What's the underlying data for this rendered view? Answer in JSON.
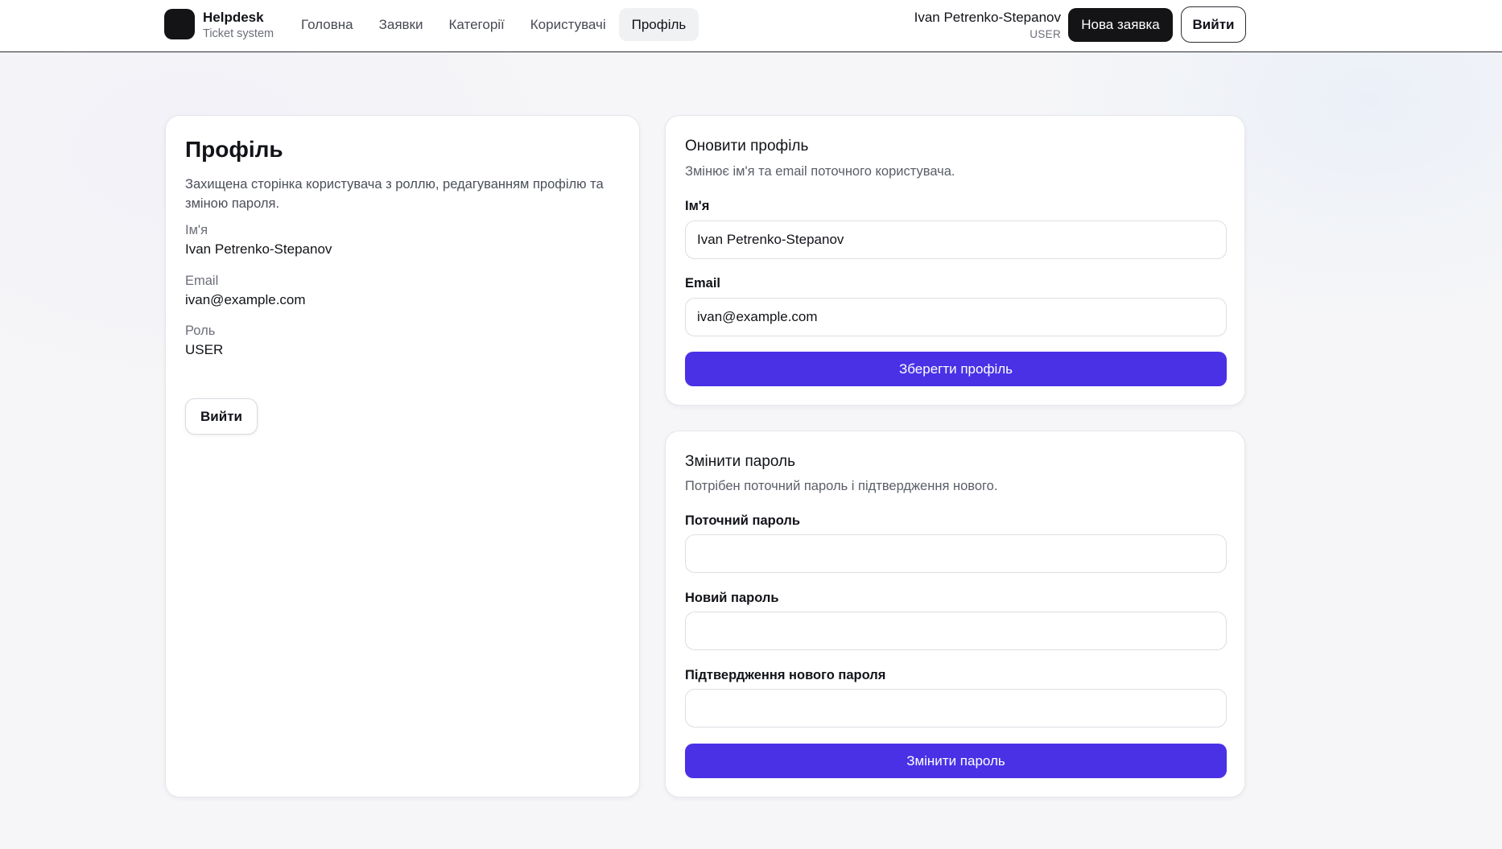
{
  "header": {
    "brand_title": "Helpdesk",
    "brand_subtitle": "Ticket system",
    "nav": [
      {
        "label": "Головна",
        "active": false
      },
      {
        "label": "Заявки",
        "active": false
      },
      {
        "label": "Категорії",
        "active": false
      },
      {
        "label": "Користувачі",
        "active": false
      },
      {
        "label": "Профіль",
        "active": true
      }
    ],
    "user_name": "Ivan Petrenko-Stepanov",
    "user_role": "USER",
    "new_ticket_label": "Нова заявка",
    "logout_label": "Вийти"
  },
  "profile_card": {
    "title": "Профіль",
    "description": "Захищена сторінка користувача з роллю, редагуванням профілю та зміною пароля.",
    "name_label": "Ім'я",
    "name_value": "Ivan Petrenko-Stepanov",
    "email_label": "Email",
    "email_value": "ivan@example.com",
    "role_label": "Роль",
    "role_value": "USER",
    "logout_label": "Вийти"
  },
  "update_profile": {
    "title": "Оновити профіль",
    "subtitle": "Змінює ім'я та email поточного користувача.",
    "name_label": "Ім'я",
    "name_value": "Ivan Petrenko-Stepanov",
    "email_label": "Email",
    "email_value": "ivan@example.com",
    "submit_label": "Зберегти профіль"
  },
  "change_password": {
    "title": "Змінити пароль",
    "subtitle": "Потрібен поточний пароль і підтвердження нового.",
    "current_label": "Поточний пароль",
    "current_value": "",
    "new_label": "Новий пароль",
    "new_value": "",
    "confirm_label": "Підтвердження нового пароля",
    "confirm_value": "",
    "submit_label": "Змінити пароль"
  },
  "colors": {
    "primary": "#4a31e6",
    "dark": "#141416"
  }
}
